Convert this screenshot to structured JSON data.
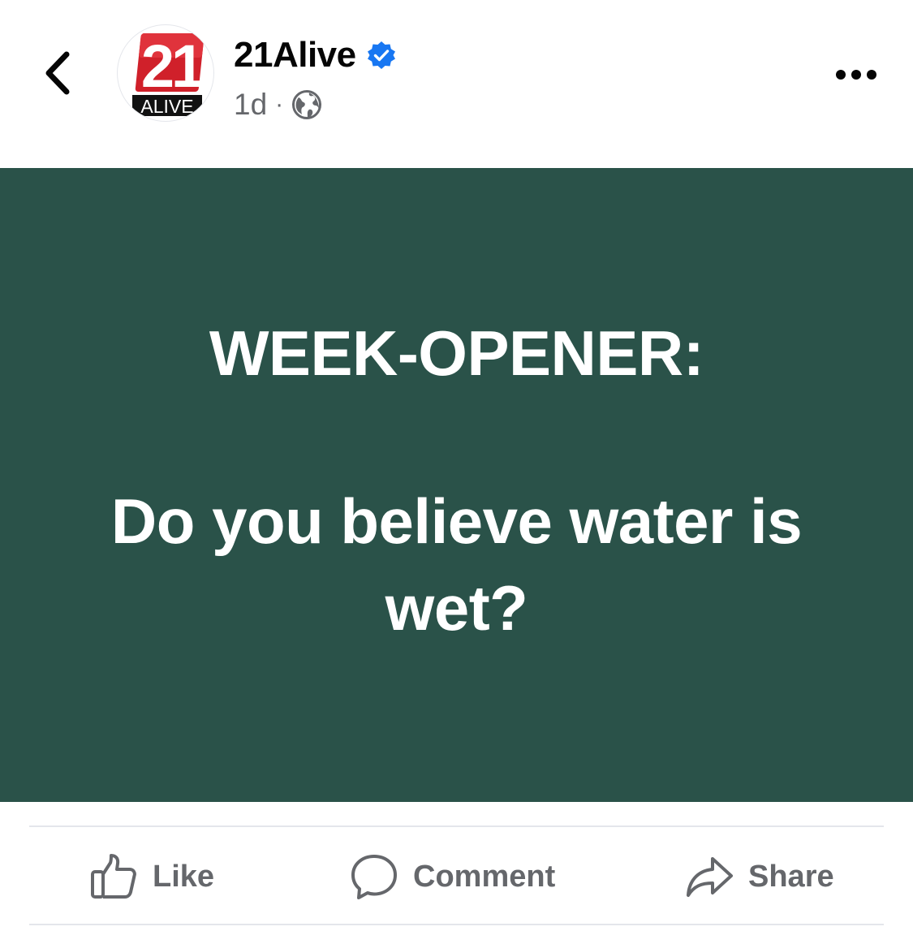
{
  "header": {
    "page_name": "21Alive",
    "verified": true,
    "timestamp": "1d",
    "separator": "·",
    "audience_icon": "globe-icon",
    "back_icon": "chevron-left-icon",
    "more_icon": "more-dots-icon"
  },
  "avatar": {
    "logo_number": "21",
    "logo_text": "ALIVE"
  },
  "post": {
    "heading": "WEEK-OPENER:",
    "question": "Do you believe water is wet?",
    "background_color": "#2a5249",
    "text_color": "#ffffff"
  },
  "actions": {
    "like_label": "Like",
    "comment_label": "Comment",
    "share_label": "Share"
  },
  "colors": {
    "verified_badge": "#1877f2",
    "secondary_text": "#65676b",
    "logo_red": "#d0202a"
  }
}
